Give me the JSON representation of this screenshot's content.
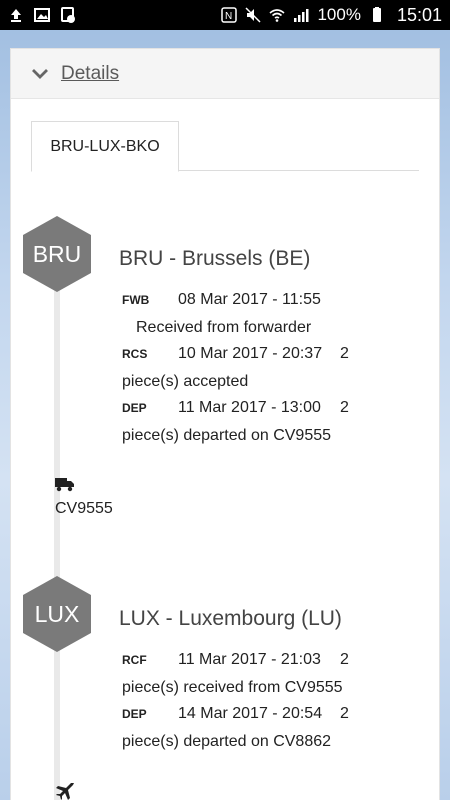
{
  "status_bar": {
    "battery": "100%",
    "time": "15:01",
    "icons": [
      "upload-icon",
      "image-icon",
      "gallery-icon",
      "nfc-icon",
      "mute-icon",
      "wifi-icon",
      "signal-icon",
      "battery-icon"
    ]
  },
  "details": {
    "label": "Details"
  },
  "tabs": [
    {
      "label": "BRU-LUX-BKO"
    }
  ],
  "stops": [
    {
      "code": "BRU",
      "title": "BRU - Brussels (BE)",
      "events": [
        {
          "code": "FWB",
          "date": "08 Mar 2017 - 11:55",
          "count": "",
          "desc": "Received from forwarder"
        },
        {
          "code": "RCS",
          "date": "10 Mar 2017 - 20:37",
          "count": "2",
          "desc": "piece(s) accepted"
        },
        {
          "code": "DEP",
          "date": "11 Mar 2017 - 13:00",
          "count": "2",
          "desc": "piece(s) departed on CV9555"
        }
      ],
      "transport": {
        "icon": "truck-icon",
        "label": "CV9555"
      }
    },
    {
      "code": "LUX",
      "title": "LUX - Luxembourg (LU)",
      "events": [
        {
          "code": "RCF",
          "date": "11 Mar 2017 - 21:03",
          "count": "2",
          "desc": "piece(s) received from CV9555"
        },
        {
          "code": "DEP",
          "date": "14 Mar 2017 - 20:54",
          "count": "2",
          "desc": "piece(s) departed on CV8862"
        }
      ],
      "transport": {
        "icon": "plane-icon",
        "label": ""
      }
    }
  ],
  "colors": {
    "hex": "#7a7a7a",
    "timeline": "#e9e9e9",
    "header_bg": "#f5f5f5"
  }
}
